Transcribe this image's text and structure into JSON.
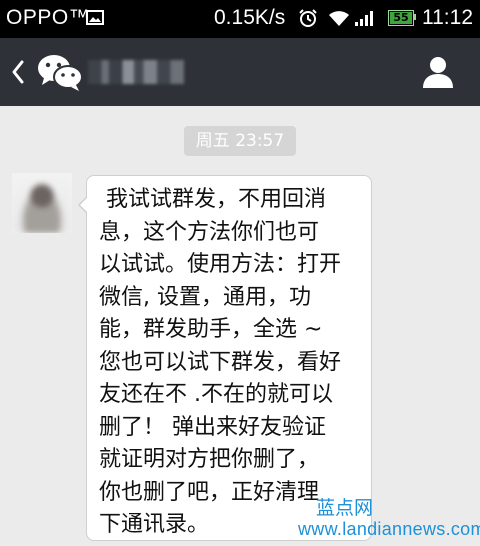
{
  "status_bar": {
    "carrier": "OPPO™",
    "net_speed": "0.15K/s",
    "battery_level": "55",
    "time": "11:12",
    "icons": [
      "image-icon",
      "alarm-icon",
      "wifi-icon",
      "signal-icon",
      "battery-icon"
    ]
  },
  "title_bar": {
    "contact_name": "███",
    "icons": [
      "back-chevron-icon",
      "wechat-logo-icon",
      "profile-icon"
    ]
  },
  "chat": {
    "timestamp": "周五 23:57",
    "messages": [
      {
        "from": "contact",
        "avatar": "blurred",
        "lines": [
          " 我试试群发，不用回消",
          "息，这个方法你们也可",
          "以试试。使用方法：打开",
          "微信, 设置，通用，功",
          "能，群发助手，全选 ~",
          "您也可以试下群发，看好",
          "友还在不 .不在的就可以",
          "删了！ 弹出来好友验证",
          "就证明对方把你删了，",
          "你也删了吧，正好清理",
          "下通讯录。"
        ]
      }
    ]
  },
  "watermark": {
    "title": "蓝点网",
    "url": "www.landiannews.com",
    "color": "#1d90d8"
  },
  "colors": {
    "title_bar": "#2e3238",
    "chat_background": "#ebebeb",
    "timestamp_pill": "#d5d5d5"
  }
}
